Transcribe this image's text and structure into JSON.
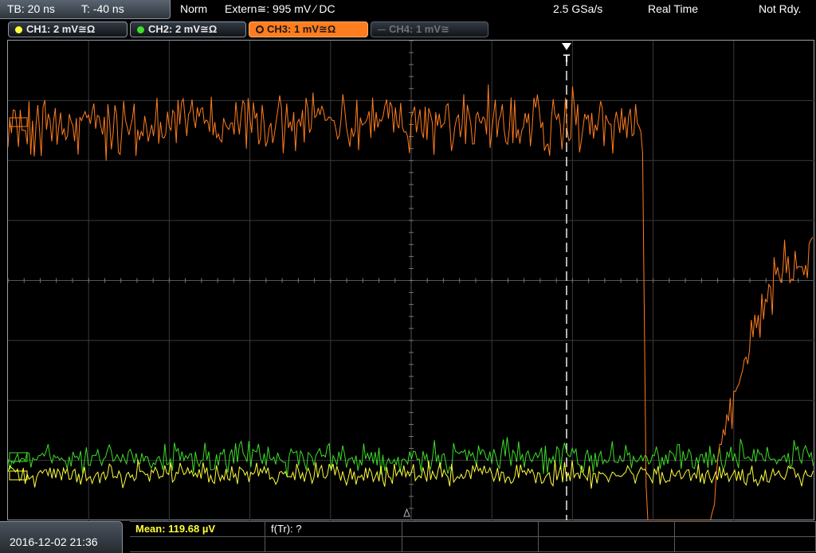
{
  "header": {
    "timebase": "TB: 20 ns",
    "trigger_offset": "T: -40 ns",
    "acquisition_mode": "Norm",
    "trigger_source": "Extern≅: 995 mV ⁄ DC",
    "sample_rate": "2.5 GSa/s",
    "acquisition_type": "Real Time",
    "status": "Not Rdy."
  },
  "channels": [
    {
      "label": "CH1: 2 mV≅Ω",
      "color": "#ffff3a",
      "state": "on"
    },
    {
      "label": "CH2: 2 mV≅Ω",
      "color": "#3cde28",
      "state": "on"
    },
    {
      "label": "CH3: 1 mV≅Ω",
      "color": "#ff7d1e",
      "state": "selected"
    },
    {
      "label": "CH4: 1 mV≅",
      "color": "#6e7278",
      "state": "off"
    }
  ],
  "trigger_marker": "T",
  "footer": {
    "datetime": "2016-12-02 21:36",
    "measurements": [
      {
        "label": "Mean: 119.68 µV",
        "color": "#ffff3a"
      },
      {
        "label": "f(Tr): ?",
        "color": "#ffffff"
      }
    ]
  },
  "icons": {
    "trigger-marker": "down-triangle-T",
    "channel-dot": "filled-circle"
  }
}
